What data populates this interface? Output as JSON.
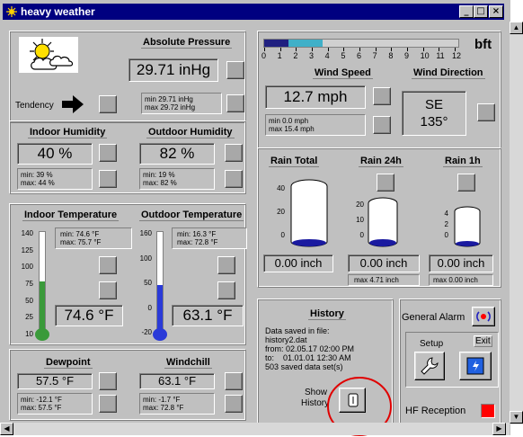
{
  "window": {
    "title": "heavy weather",
    "min_label": "_",
    "max_label": "□",
    "close_label": "×"
  },
  "pressure": {
    "title": "Absolute Pressure",
    "value": "29.71 inHg",
    "min": "min 29.71 inHg",
    "max": "max 29.72 inHg",
    "tendency_label": "Tendency"
  },
  "wind": {
    "scale_unit": "bft",
    "scale_ticks": [
      "0",
      "1",
      "2",
      "3",
      "4",
      "5",
      "6",
      "7",
      "8",
      "9",
      "10",
      "11",
      "12"
    ],
    "bft_level": 3.7,
    "speed_title": "Wind Speed",
    "speed_value": "12.7 mph",
    "speed_min": "min 0.0 mph",
    "speed_max": "max 15.4 mph",
    "dir_title": "Wind Direction",
    "dir_value": "SE",
    "dir_degrees": "135°"
  },
  "humidity": {
    "indoor_title": "Indoor Humidity",
    "indoor_value": "40 %",
    "indoor_min": "min: 39 %",
    "indoor_max": "max: 44 %",
    "outdoor_title": "Outdoor Humidity",
    "outdoor_value": "82 %",
    "outdoor_min": "min: 19 %",
    "outdoor_max": "max: 82 %"
  },
  "temperature": {
    "indoor_title": "Indoor Temperature",
    "indoor_value": "74.6 °F",
    "indoor_min": "min: 74.6 °F",
    "indoor_max": "max: 75.7 °F",
    "indoor_scale": [
      "140",
      "125",
      "100",
      "75",
      "50",
      "25",
      "10"
    ],
    "indoor_level": 74.6,
    "outdoor_title": "Outdoor Temperature",
    "outdoor_value": "63.1 °F",
    "outdoor_min": "min: 16.3 °F",
    "outdoor_max": "max: 72.8 °F",
    "outdoor_scale": [
      "160",
      "100",
      "50",
      "0",
      "-20"
    ],
    "outdoor_level": 63.1
  },
  "dew": {
    "dew_title": "Dewpoint",
    "dew_value": "57.5 °F",
    "dew_min": "min: -12.1 °F",
    "dew_max": "max: 57.5 °F",
    "chill_title": "Windchill",
    "chill_value": "63.1 °F",
    "chill_min": "min: -1.7 °F",
    "chill_max": "max: 72.8 °F"
  },
  "rain": {
    "total_title": "Rain Total",
    "total_value": "0.00 inch",
    "total_scale": [
      "40",
      "20",
      "0"
    ],
    "day_title": "Rain 24h",
    "day_value": "0.00 inch",
    "day_scale": [
      "20",
      "10",
      "0"
    ],
    "day_max": "max 4.71 inch",
    "hour_title": "Rain 1h",
    "hour_value": "0.00 inch",
    "hour_scale": [
      "4",
      "2",
      "0"
    ],
    "hour_max": "max 0.00 inch"
  },
  "history": {
    "title": "History",
    "line1": "Data saved in file:",
    "line2": "history2.dat",
    "line3": "from: 02.05.17 02:00 PM",
    "line4": "to:    01.01.01 12:30 AM",
    "line5": "503 saved data set(s)",
    "show_label_1": "Show",
    "show_label_2": "History"
  },
  "controls": {
    "alarm_label": "General Alarm",
    "setup_label": "Setup",
    "exit_label": "Exit",
    "hf_label": "HF Reception"
  },
  "colors": {
    "titlebar": "#000080",
    "face": "#c0c0c0",
    "bft_fill": "#40b0c8",
    "thermo_in": "#3a9a3a",
    "thermo_out": "#2a3ad8",
    "rain": "#1a1aa0",
    "alarm": "#ff0000",
    "highlight_circle": "#e00000"
  }
}
